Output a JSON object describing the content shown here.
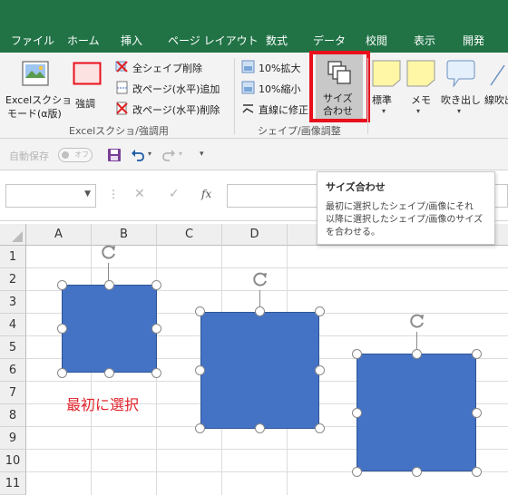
{
  "menu_tabs": [
    "ファイル",
    "ホーム",
    "挿入",
    "ページ レイアウト",
    "数式",
    "データ",
    "校閲",
    "表示",
    "開発"
  ],
  "ribbon": {
    "screenshot_btn": {
      "line1": "Excelスクショ",
      "line2": "モード(α版)"
    },
    "emphasis_btn": "強調",
    "delete_all_shapes": "全シェイプ削除",
    "page_break_horizontal_add": "改ページ(水平)追加",
    "page_break_horizontal_delete": "改ページ(水平)削除",
    "group1_label": "Excelスクショ/強調用",
    "zoom_in": "10%拡大",
    "zoom_out": "10%縮小",
    "line_fix": "直線に修正",
    "size_match": {
      "line1": "サイズ",
      "line2": "合わせ"
    },
    "group2_label": "シェイプ/画像調整",
    "note_standard": "標準",
    "note_memo": "メモ",
    "note_callout": "吹き出し",
    "note_line": "線吹出"
  },
  "qat": {
    "autosave_label": "自動保存",
    "autosave_state": "オフ"
  },
  "formula_bar": {
    "name_box": "",
    "fx": "fx",
    "formula": ""
  },
  "columns": [
    "A",
    "B",
    "C",
    "D"
  ],
  "rows": [
    "1",
    "2",
    "3",
    "4",
    "5",
    "6",
    "7",
    "8",
    "9",
    "10",
    "11"
  ],
  "annotation": "最初に選択",
  "tooltip": {
    "title": "サイズ合わせ",
    "desc_line1": "最初に選択したシェイプ/画像にそれ",
    "desc_line2": "以降に選択したシェイプ/画像のサイズ",
    "desc_line3": "を合わせる。"
  },
  "colors": {
    "excel_green": "#217346",
    "shape_fill": "#4472c4",
    "highlight": "#e8101d",
    "annotation": "#e0202a"
  }
}
